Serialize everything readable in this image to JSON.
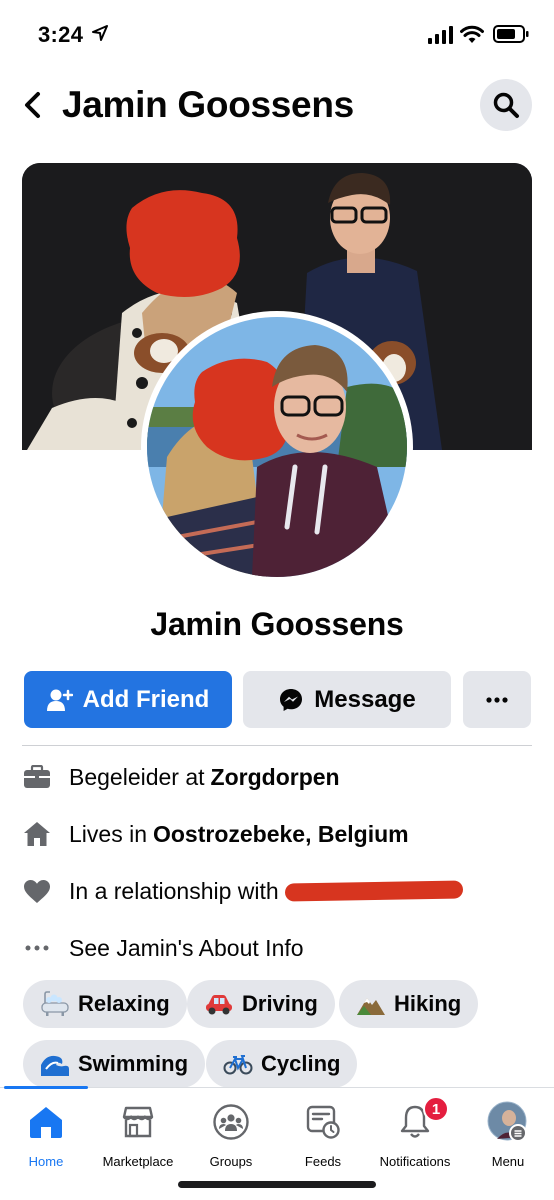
{
  "status_bar": {
    "time": "3:24"
  },
  "header": {
    "title": "Jamin Goossens"
  },
  "profile": {
    "name": "Jamin Goossens",
    "add_friend_label": "Add Friend",
    "message_label": "Message"
  },
  "info": {
    "work_prefix": "Begeleider at",
    "work_place": "Zorgdorpen",
    "lives_prefix": "Lives in",
    "lives_place": "Oostrozebeke, Belgium",
    "relationship_prefix": "In a relationship with",
    "about_label": "See Jamin's About Info"
  },
  "hobbies": [
    {
      "label": "Relaxing",
      "icon": "bathtub-emoji"
    },
    {
      "label": "Driving",
      "icon": "car-emoji"
    },
    {
      "label": "Hiking",
      "icon": "mountain-emoji"
    },
    {
      "label": "Swimming",
      "icon": "wave-emoji"
    },
    {
      "label": "Cycling",
      "icon": "bicycle-emoji"
    }
  ],
  "tabs": [
    {
      "label": "Home",
      "icon": "home-icon",
      "active": true
    },
    {
      "label": "Marketplace",
      "icon": "marketplace-icon"
    },
    {
      "label": "Groups",
      "icon": "groups-icon"
    },
    {
      "label": "Feeds",
      "icon": "feeds-icon"
    },
    {
      "label": "Notifications",
      "icon": "bell-icon",
      "badge": "1"
    },
    {
      "label": "Menu",
      "icon": "avatar-menu-icon"
    }
  ],
  "colors": {
    "accent": "#1877f2",
    "button_blue": "#2374e1",
    "chip_bg": "#e4e6eb",
    "badge": "#e41e3f",
    "redaction": "#d7351f"
  }
}
